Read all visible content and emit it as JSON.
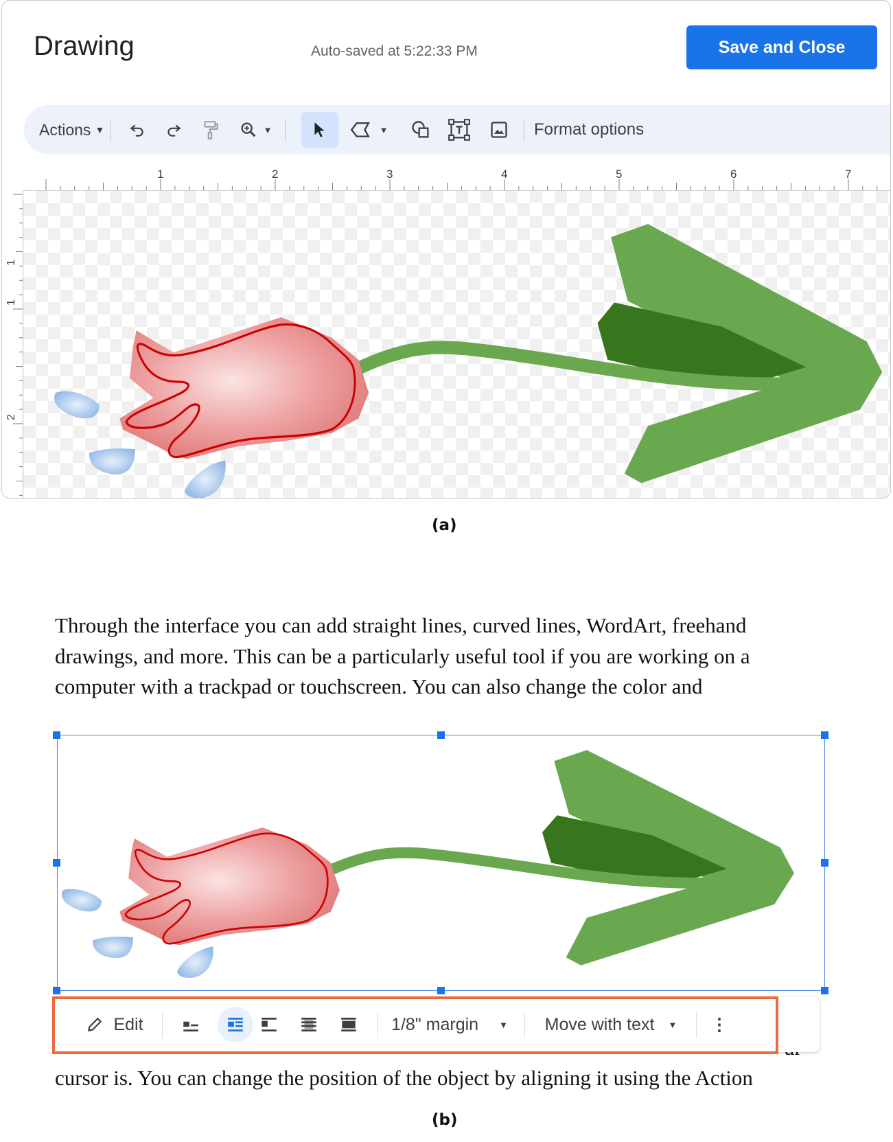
{
  "dialog": {
    "title": "Drawing",
    "autosave": "Auto-saved at 5:22:33 PM",
    "save_button": "Save and Close",
    "toolbar": {
      "actions_label": "Actions",
      "format_options_label": "Format options",
      "icons": [
        "undo-icon",
        "redo-icon",
        "paint-format-icon",
        "zoom-icon",
        "select-icon",
        "line-icon",
        "shape-icon",
        "text-box-icon",
        "image-icon"
      ]
    },
    "ruler": {
      "horizontal": [
        "1",
        "2",
        "3",
        "4",
        "5",
        "6",
        "7"
      ],
      "vertical": [
        "1",
        "1",
        "2"
      ]
    }
  },
  "caption_a": "(a)",
  "document": {
    "lines": [
      "Through the interface you can add straight lines, curved lines, WordArt, freehand",
      "drawings, and more. This can be a particularly useful tool if you are working on a",
      "computer with a trackpad or touchscreen. You can also change the color and"
    ],
    "fragment_right": ",",
    "fragment_line_end": "ur",
    "last_line": "cursor is. You can change the position of the object by aligning it using the Action",
    "image_toolbar": {
      "edit_label": "Edit",
      "margin_label": "1/8\" margin",
      "move_label": "Move with text"
    }
  },
  "caption_b": "(b)",
  "colors": {
    "accent": "#1a73e8",
    "highlight": "#ee6a3c",
    "leaf_light": "#6aa84f",
    "leaf_dark": "#38761d",
    "flower": "#e06666",
    "drops": "#9fc5e8"
  }
}
